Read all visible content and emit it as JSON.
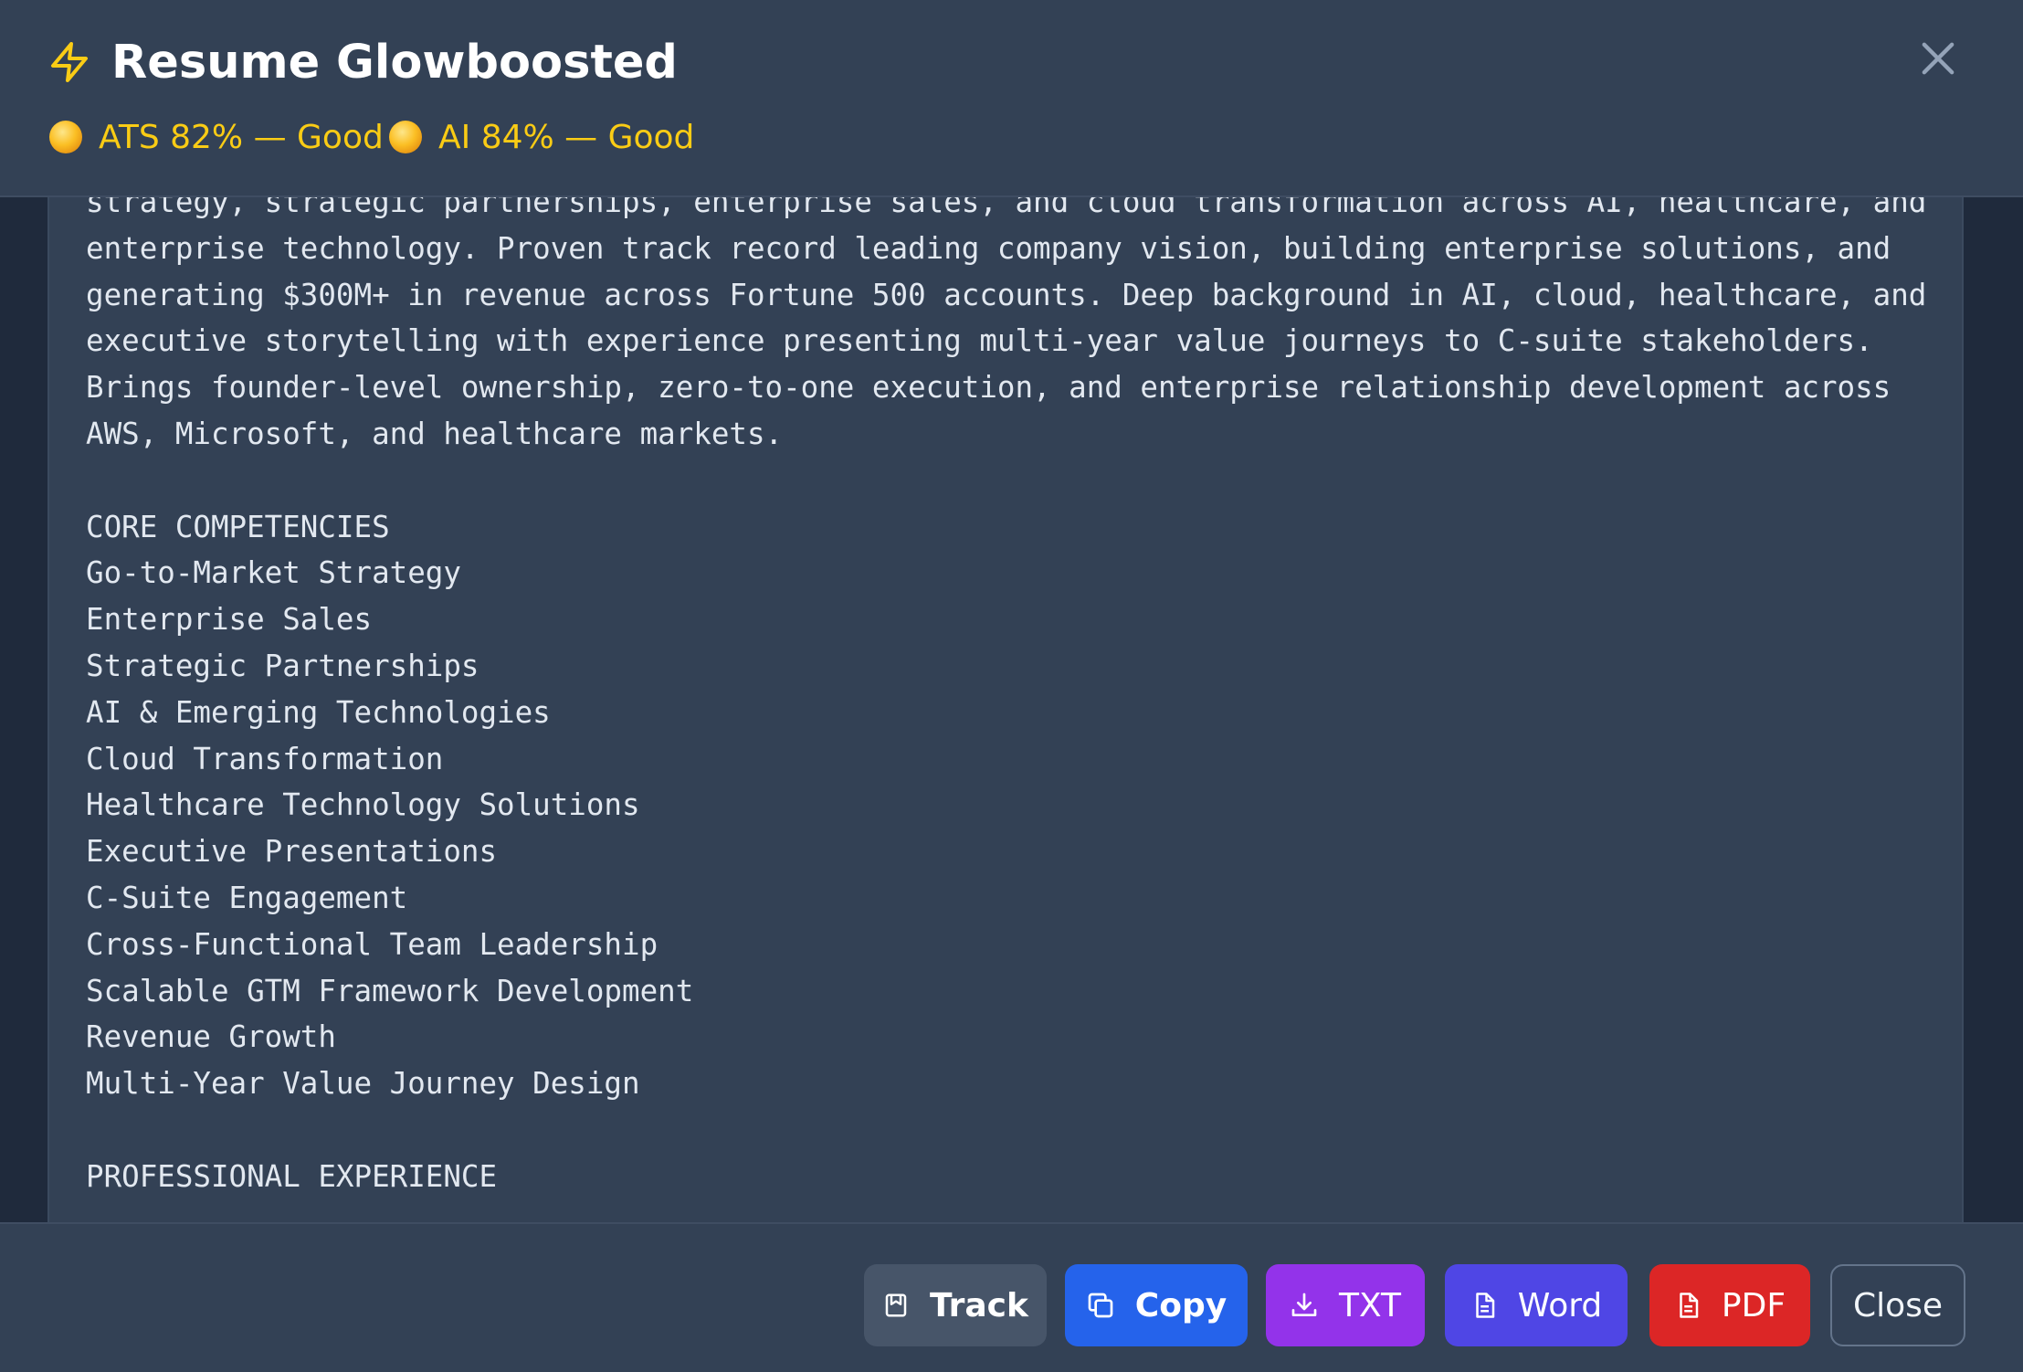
{
  "header": {
    "title": "Resume Glowboosted",
    "title_icon": "lightning-bolt-icon",
    "close_icon": "close-icon",
    "badges": [
      {
        "label": "ATS 82% — Good",
        "color": "#facc15"
      },
      {
        "label": "AI 84% — Good",
        "color": "#facc15"
      }
    ]
  },
  "content": {
    "resume_lines": [
      "strategy, strategic partnerships, enterprise sales, and cloud transformation across AI, healthcare, and",
      "enterprise technology. Proven track record leading company vision, building enterprise solutions, and",
      "generating $300M+ in revenue across Fortune 500 accounts. Deep background in AI, cloud, healthcare, and",
      "executive storytelling with experience presenting multi-year value journeys to C-suite stakeholders.",
      "Brings founder-level ownership, zero-to-one execution, and enterprise relationship development across",
      "AWS, Microsoft, and healthcare markets.",
      "",
      "CORE COMPETENCIES",
      "Go-to-Market Strategy",
      "Enterprise Sales",
      "Strategic Partnerships",
      "AI & Emerging Technologies",
      "Cloud Transformation",
      "Healthcare Technology Solutions",
      "Executive Presentations",
      "C-Suite Engagement",
      "Cross-Functional Team Leadership",
      "Scalable GTM Framework Development",
      "Revenue Growth",
      "Multi-Year Value Journey Design",
      "",
      "PROFESSIONAL EXPERIENCE"
    ]
  },
  "footer": {
    "buttons": [
      {
        "label": "Track",
        "icon": "bookmark-icon",
        "color": "#475569"
      },
      {
        "label": "Copy",
        "icon": "copy-icon",
        "color": "#2563eb"
      },
      {
        "label": "TXT",
        "icon": "download-icon",
        "color": "#9333ea"
      },
      {
        "label": "Word",
        "icon": "document-icon",
        "color": "#4f46e5"
      },
      {
        "label": "PDF",
        "icon": "pdf-document-icon",
        "color": "#dc2626"
      },
      {
        "label": "Close",
        "icon": "",
        "color": "transparent"
      }
    ]
  }
}
